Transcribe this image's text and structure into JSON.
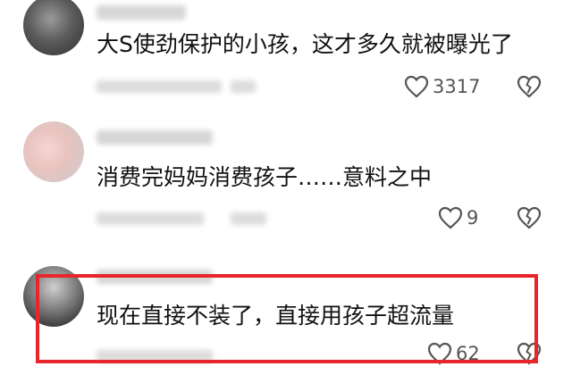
{
  "comments": [
    {
      "text": "大S使劲保护的小孩，这才多久就被曝光了",
      "likes": "3317",
      "icons": [
        "heart-outline-icon",
        "broken-heart-icon"
      ]
    },
    {
      "text": "消费完妈妈消费孩子……意料之中",
      "likes": "9",
      "icons": [
        "heart-outline-icon",
        "broken-heart-icon"
      ]
    },
    {
      "text": "现在直接不装了，直接用孩子超流量",
      "likes": "62",
      "icons": [
        "heart-outline-icon",
        "broken-heart-icon"
      ]
    }
  ],
  "highlight_color": "#e8252a"
}
